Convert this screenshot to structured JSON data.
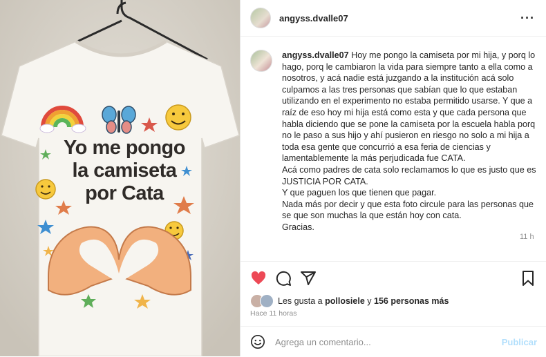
{
  "post": {
    "username": "angyss.dvalle07",
    "caption_user": "angyss.dvalle07",
    "caption_text": "Hoy me pongo la camiseta por mi hija, y porq lo hago, porq le cambiaron la vida para siempre tanto a ella como a nosotros, y acá nadie está juzgando a la institución acá solo culpamos a las tres personas que sabían que lo que estaban utilizando en el experimento no estaba permitido usarse. Y que a raíz de eso hoy mi hija está como esta y que cada persona que habla diciendo que se pone la camiseta por la escuela habla porq no le paso a sus hijo y ahí pusieron en riesgo no solo a mi hija a toda esa gente que concurrió a esa feria de ciencias y lamentablemente la más perjudicada fue CATA.\nAcá como padres de cata solo reclamamos lo que es justo que es JUSTICIA POR CATA.\nY que paguen los que tienen que pagar.\nNada más por decir y que esta foto circule para las personas que se que son muchas la que están hoy con cata.\nGracias.",
    "caption_time": "11 h",
    "likes_prefix": "Les gusta a",
    "likes_user": "pollosiele",
    "likes_connector": "y",
    "likes_count": "156 personas más",
    "posted_ago": "Hace 11 horas",
    "comment_placeholder": "Agrega un comentario...",
    "publish_label": "Publicar"
  },
  "shirt": {
    "line1": "Yo me pongo",
    "line2": "la camiseta",
    "line3": "por Cata"
  },
  "colors": {
    "like_red": "#ed4956",
    "publish_blue": "#b2dffc"
  },
  "icons": [
    "more-options-icon",
    "heart-icon",
    "comment-icon",
    "share-icon",
    "bookmark-icon",
    "emoji-icon"
  ]
}
